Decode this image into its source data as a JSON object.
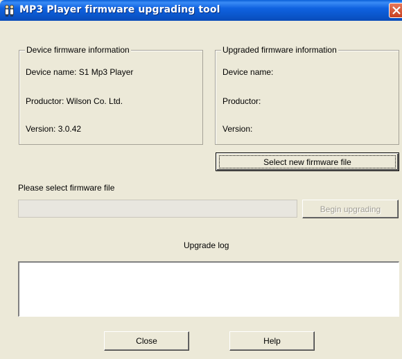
{
  "window": {
    "title": "MP3 Player firmware upgrading tool",
    "accent_color": "#0a54c8",
    "close_color": "#d6532f"
  },
  "device_info": {
    "legend": "Device firmware information",
    "device_name": "Device name: S1 Mp3 Player",
    "productor": "Productor: Wilson Co. Ltd.",
    "version": "Version: 3.0.42"
  },
  "upgraded_info": {
    "legend": "Upgraded firmware information",
    "device_name": "Device name:",
    "productor": "Productor:",
    "version": "Version:"
  },
  "buttons": {
    "select_file": "Select new firmware file",
    "begin_upgrading": "Begin upgrading",
    "close": "Close",
    "help": "Help"
  },
  "file_select": {
    "prompt": "Please select firmware file",
    "path_value": ""
  },
  "log": {
    "label": "Upgrade log",
    "content": ""
  },
  "icons": {
    "app": "app-figures-icon",
    "close": "close-icon"
  }
}
